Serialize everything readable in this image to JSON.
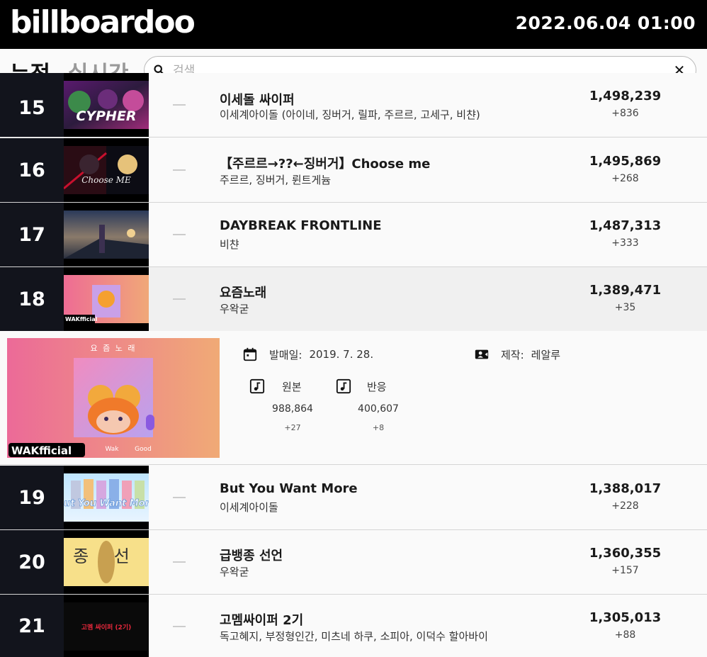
{
  "header": {
    "logo": "billboardoo",
    "datetime": "2022.06.04 01:00"
  },
  "tabs": {
    "cumulative": "누적",
    "realtime": "실시간"
  },
  "search": {
    "placeholder": "검색",
    "value": ""
  },
  "chart": [
    {
      "rank": "15",
      "title": "이세돌 싸이퍼",
      "artist": "이세계아이돌 (아이네, 징버거, 릴파, 주르르, 고세구, 비챤)",
      "views": "1,498,239",
      "delta": "+836",
      "thumb_text": "CYPHER"
    },
    {
      "rank": "16",
      "title": "【주르르→??←징버거】Choose me",
      "artist": "주르르, 징버거, 륀트게늄",
      "views": "1,495,869",
      "delta": "+268",
      "thumb_text": "Choose ME"
    },
    {
      "rank": "17",
      "title": "DAYBREAK FRONTLINE",
      "artist": "비챤",
      "views": "1,487,313",
      "delta": "+333",
      "thumb_text": ""
    },
    {
      "rank": "18",
      "title": "요즘노래",
      "artist": "우왁굳",
      "views": "1,389,471",
      "delta": "+35",
      "thumb_text": "WAKfficial"
    },
    {
      "rank": "19",
      "title": "But You Want More",
      "artist": "이세계아이돌",
      "views": "1,388,017",
      "delta": "+228",
      "thumb_text": "But You Want More"
    },
    {
      "rank": "20",
      "title": "급뱅종 선언",
      "artist": "우왁굳",
      "views": "1,360,355",
      "delta": "+157",
      "thumb_text": "급 종 선 언"
    },
    {
      "rank": "21",
      "title": "고멤싸이퍼 2기",
      "artist": "독고혜지, 부정형인간, 미츠네 하쿠, 소피아, 이덕수 할아바이",
      "views": "1,305,013",
      "delta": "+88",
      "thumb_text": "고멤 싸이퍼 (2기)"
    }
  ],
  "detail": {
    "cover_title": "요 즘 노 래",
    "cover_brand": "WAKfficial",
    "cover_tags": [
      "Wak",
      "Good"
    ],
    "release_label": "발매일:",
    "release_date": "2019. 7. 28.",
    "producer_label": "제작:",
    "producer": "레알루",
    "original_label": "원본",
    "original_views": "988,864",
    "original_delta": "+27",
    "reaction_label": "반응",
    "reaction_views": "400,607",
    "reaction_delta": "+8"
  },
  "colors": {
    "header_bg": "#000000",
    "rank_bg": "#12141c",
    "selected_row": "#f0f0f0"
  }
}
